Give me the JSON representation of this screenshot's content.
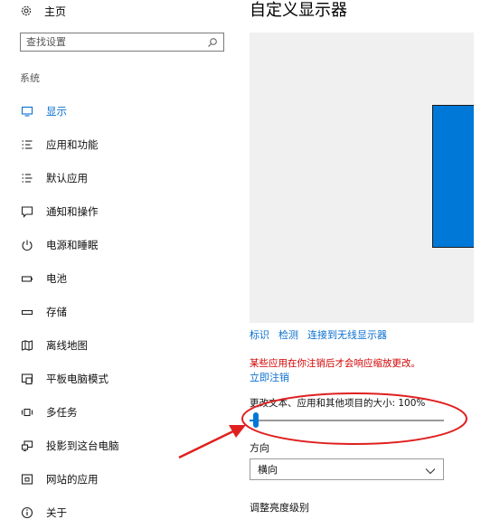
{
  "sidebar": {
    "home_label": "主页",
    "search": {
      "placeholder": "查找设置",
      "value": ""
    },
    "section_label": "系统",
    "items": [
      {
        "label": "显示",
        "icon": "monitor-icon",
        "active": true
      },
      {
        "label": "应用和功能",
        "icon": "apps-list-icon",
        "active": false
      },
      {
        "label": "默认应用",
        "icon": "default-apps-icon",
        "active": false
      },
      {
        "label": "通知和操作",
        "icon": "notification-icon",
        "active": false
      },
      {
        "label": "电源和睡眠",
        "icon": "power-icon",
        "active": false
      },
      {
        "label": "电池",
        "icon": "battery-icon",
        "active": false
      },
      {
        "label": "存储",
        "icon": "storage-icon",
        "active": false
      },
      {
        "label": "离线地图",
        "icon": "map-icon",
        "active": false
      },
      {
        "label": "平板电脑模式",
        "icon": "tablet-mode-icon",
        "active": false
      },
      {
        "label": "多任务",
        "icon": "multitasking-icon",
        "active": false
      },
      {
        "label": "投影到这台电脑",
        "icon": "project-icon",
        "active": false
      },
      {
        "label": "网站的应用",
        "icon": "web-apps-icon",
        "active": false
      },
      {
        "label": "关于",
        "icon": "info-icon",
        "active": false
      }
    ]
  },
  "main": {
    "title": "自定义显示器",
    "links": {
      "identify": "标识",
      "detect": "检测",
      "connect_wireless": "连接到无线显示器"
    },
    "warning": "某些应用在你注销后才会响应缩放更改。",
    "sign_out": "立即注销",
    "scale_label": "更改文本、应用和其他项目的大小: 100%",
    "scale_value_fraction": 0.02,
    "orientation_label": "方向",
    "orientation_value": "横向",
    "brightness_label": "调整亮度级别"
  },
  "colors": {
    "accent": "#0078d7",
    "link": "#0a6fcf",
    "warning": "#d10000",
    "annotation": "#e02020"
  }
}
